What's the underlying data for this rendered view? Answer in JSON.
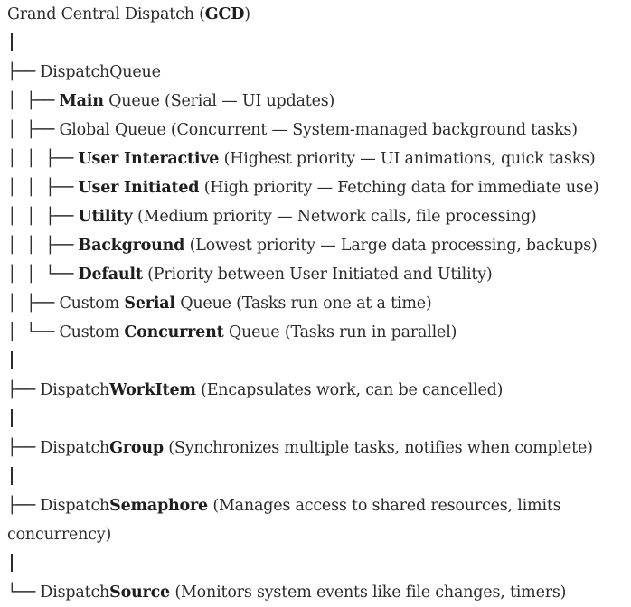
{
  "title": {
    "prefix": "Grand Central Dispatch (",
    "bold": "GCD",
    "suffix": ")"
  },
  "rows": [
    {
      "type": "pipe",
      "prefix": "",
      "pre": "",
      "bold": "",
      "post": ""
    },
    {
      "type": "node",
      "prefix": "├── ",
      "pre": "DispatchQueue",
      "bold": "",
      "post": ""
    },
    {
      "type": "node",
      "prefix": "│  ├── ",
      "pre": "",
      "bold": "Main",
      "post": " Queue (Serial — UI updates)"
    },
    {
      "type": "node",
      "prefix": "│  ├── ",
      "pre": "Global Queue (Concurrent — System-managed background tasks)",
      "bold": "",
      "post": ""
    },
    {
      "type": "node",
      "prefix": "│  │  ├── ",
      "pre": "",
      "bold": "User Interactive",
      "post": " (Highest priority — UI animations, quick tasks)"
    },
    {
      "type": "node",
      "prefix": "│  │  ├── ",
      "pre": "",
      "bold": "User Initiated",
      "post": " (High priority — Fetching data for immediate use)"
    },
    {
      "type": "node",
      "prefix": "│  │  ├── ",
      "pre": "",
      "bold": "Utility",
      "post": " (Medium priority — Network calls, file processing)"
    },
    {
      "type": "node",
      "prefix": "│  │  ├── ",
      "pre": "",
      "bold": "Background",
      "post": " (Lowest priority — Large data processing, backups)"
    },
    {
      "type": "node",
      "prefix": "│  │  └── ",
      "pre": "",
      "bold": "Default",
      "post": " (Priority between User Initiated and Utility)"
    },
    {
      "type": "node",
      "prefix": "│  ├── ",
      "pre": "Custom ",
      "bold": "Serial",
      "post": " Queue (Tasks run one at a time)"
    },
    {
      "type": "node",
      "prefix": "│  └── ",
      "pre": "Custom ",
      "bold": "Concurrent",
      "post": " Queue (Tasks run in parallel)"
    },
    {
      "type": "pipe",
      "prefix": "",
      "pre": "",
      "bold": "",
      "post": ""
    },
    {
      "type": "node",
      "prefix": "├── ",
      "pre": "Dispatch",
      "bold": "WorkItem",
      "post": " (Encapsulates work, can be cancelled)"
    },
    {
      "type": "pipe",
      "prefix": "",
      "pre": "",
      "bold": "",
      "post": ""
    },
    {
      "type": "node",
      "prefix": "├── ",
      "pre": "Dispatch",
      "bold": "Group",
      "post": " (Synchronizes multiple tasks, notifies when complete)"
    },
    {
      "type": "pipe",
      "prefix": "",
      "pre": "",
      "bold": "",
      "post": ""
    },
    {
      "type": "node",
      "prefix": "├── ",
      "pre": "Dispatch",
      "bold": "Semaphore",
      "post": " (Manages access to shared resources, limits"
    },
    {
      "type": "cont",
      "prefix": "",
      "pre": "concurrency)",
      "bold": "",
      "post": ""
    },
    {
      "type": "pipe",
      "prefix": "",
      "pre": "",
      "bold": "",
      "post": ""
    },
    {
      "type": "node",
      "prefix": "└── ",
      "pre": "Dispatch",
      "bold": "Source",
      "post": " (Monitors system events like file changes, timers)"
    }
  ]
}
